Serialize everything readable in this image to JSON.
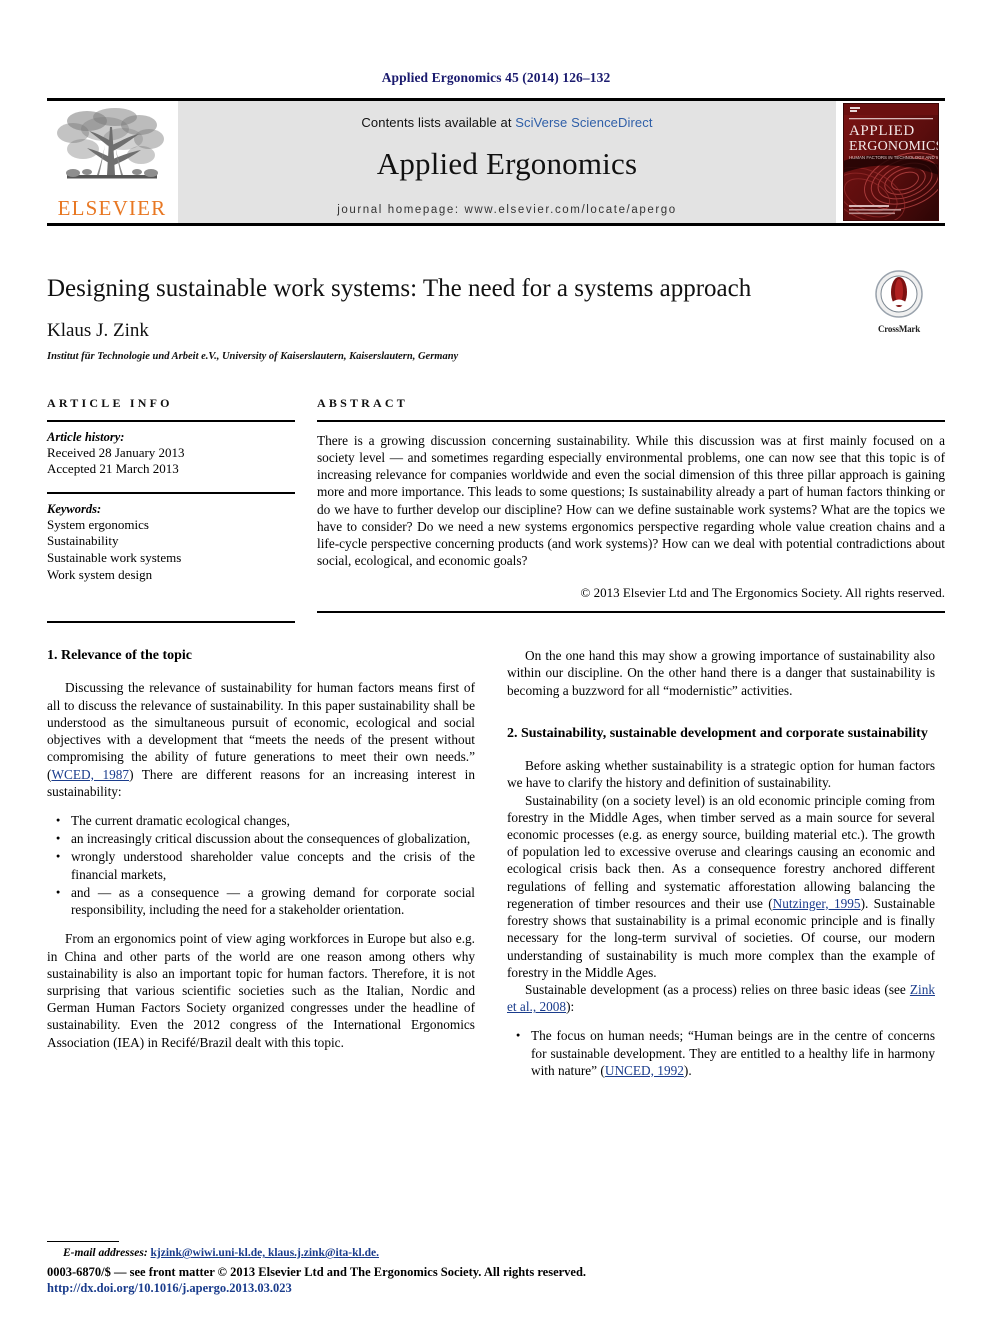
{
  "running_head": "Applied Ergonomics 45 (2014) 126–132",
  "masthead": {
    "contents_prefix": "Contents lists available at ",
    "sciencedirect_link": "SciVerse ScienceDirect",
    "journal_name": "Applied Ergonomics",
    "homepage": "journal homepage: www.elsevier.com/locate/apergo",
    "publisher_wordmark": "ELSEVIER",
    "cover_title_line1": "APPLIED",
    "cover_title_line2": "ERGONOMICS",
    "cover_subtitle": "HUMAN FACTORS IN TECHNOLOGY AND SOCIETY"
  },
  "article": {
    "title": "Designing sustainable work systems: The need for a systems approach",
    "author": "Klaus J. Zink",
    "affiliation": "Institut für Technologie und Arbeit e.V., University of Kaiserslautern, Kaiserslautern, Germany",
    "crossmark_label": "CrossMark"
  },
  "article_info": {
    "heading": "ARTICLE INFO",
    "history_label": "Article history:",
    "history": [
      "Received 28 January 2013",
      "Accepted 21 March 2013"
    ],
    "keywords_label": "Keywords:",
    "keywords": [
      "System ergonomics",
      "Sustainability",
      "Sustainable work systems",
      "Work system design"
    ]
  },
  "abstract": {
    "heading": "ABSTRACT",
    "text": "There is a growing discussion concerning sustainability. While this discussion was at first mainly focused on a society level — and sometimes regarding especially environmental problems, one can now see that this topic is of increasing relevance for companies worldwide and even the social dimension of this three pillar approach is gaining more and more importance. This leads to some questions; Is sustainability already a part of human factors thinking or do we have to further develop our discipline? How can we define sustainable work systems? What are the topics we have to consider? Do we need a new systems ergonomics perspective regarding whole value creation chains and a life-cycle perspective concerning products (and work systems)? How can we deal with potential contradictions about social, ecological, and economic goals?",
    "copyright": "© 2013 Elsevier Ltd and The Ergonomics Society. All rights reserved."
  },
  "body": {
    "left_column": {
      "section1_title": "1. Relevance of the topic",
      "p1_before_cite": "Discussing the relevance of sustainability for human factors means first of all to discuss the relevance of sustainability. In this paper sustainability shall be understood as the simultaneous pursuit of economic, ecological and social objectives with a development that “meets the needs of the present without compromising the ability of future generations to meet their own needs.” (",
      "p1_cite": "WCED, 1987",
      "p1_after_cite": ") There are different reasons for an increasing interest in sustainability:",
      "bullets": [
        "The current dramatic ecological changes,",
        "an increasingly critical discussion about the consequences of globalization,",
        "wrongly understood shareholder value concepts and the crisis of the financial markets,",
        "and — as a consequence — a growing demand for corporate social responsibility, including the need for a stakeholder orientation."
      ],
      "p2": "From an ergonomics point of view aging workforces in Europe but also e.g. in China and other parts of the world are one reason among others why sustainability is also an important topic for human factors. Therefore, it is not surprising that various scientific societies such as the Italian, Nordic and German Human Factors Society organized congresses under the headline of sustainability. Even the 2012 congress of the International Ergonomics Association (IEA) in Recifé/Brazil dealt with this topic."
    },
    "right_column": {
      "p1": "On the one hand this may show a growing importance of sustainability also within our discipline. On the other hand there is a danger that sustainability is becoming a buzzword for all “modernistic” activities.",
      "section2_title": "2. Sustainability, sustainable development and corporate sustainability",
      "p2": "Before asking whether sustainability is a strategic option for human factors we have to clarify the history and definition of sustainability.",
      "p3_before_cite": "Sustainability (on a society level) is an old economic principle coming from forestry in the Middle Ages, when timber served as a main source for several economic processes (e.g. as energy source, building material etc.). The growth of population led to excessive overuse and clearings causing an economic and ecological crisis back then. As a consequence forestry anchored different regulations of felling and systematic afforestation allowing balancing the regeneration of timber resources and their use (",
      "p3_cite": "Nutzinger, 1995",
      "p3_after_cite": "). Sustainable forestry shows that sustainability is a primal economic principle and is finally necessary for the long-term survival of societies. Of course, our modern understanding of sustainability is much more complex than the example of forestry in the Middle Ages.",
      "p4_before_cite": "Sustainable development (as a process) relies on three basic ideas (see ",
      "p4_cite": "Zink et al., 2008",
      "p4_after_cite": "):",
      "bullet1_before_cite": "The focus on human needs; “Human beings are in the centre of concerns for sustainable development. They are entitled to a healthy life in harmony with nature” (",
      "bullet1_cite": "UNCED, 1992",
      "bullet1_after_cite": ")."
    }
  },
  "footnote": {
    "label": "E-mail addresses:",
    "emails": "kjzink@wiwi.uni-kl.de, klaus.j.zink@ita-kl.de."
  },
  "footer": {
    "front_matter": "0003-6870/$ — see front matter © 2013 Elsevier Ltd and The Ergonomics Society. All rights reserved.",
    "doi": "http://dx.doi.org/10.1016/j.apergo.2013.03.023"
  },
  "colors": {
    "link_blue": "#1a3c8c",
    "sciencedirect_blue": "#2f5fa8",
    "elsevier_orange": "#E87722",
    "cover_red": "#8B1A1A",
    "running_head_blue": "#1a1a6e"
  }
}
